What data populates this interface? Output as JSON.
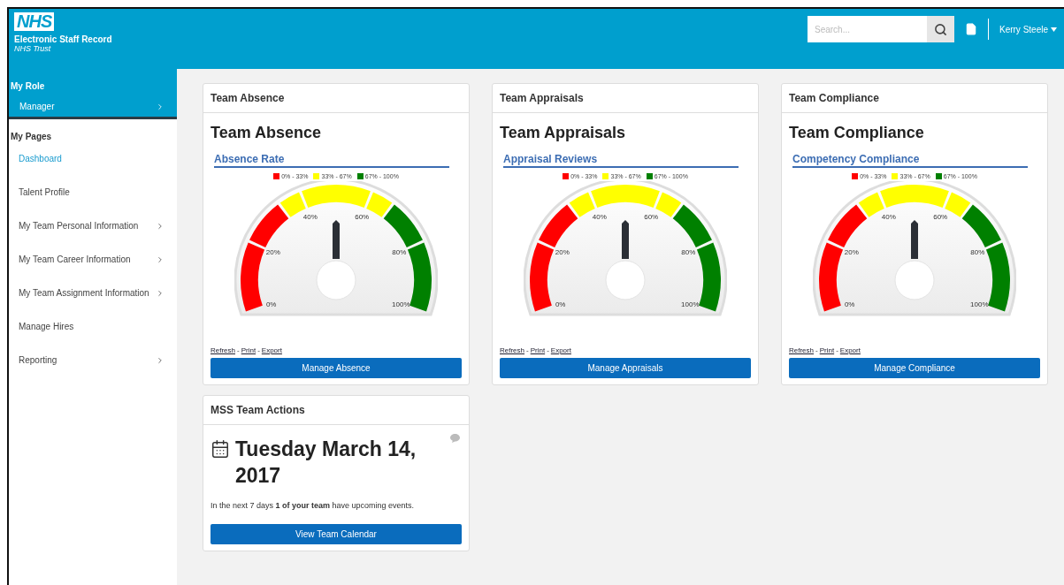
{
  "header": {
    "logo": "NHS",
    "app_name": "Electronic Staff Record",
    "org": "NHS Trust",
    "search": {
      "placeholder": "Search..."
    },
    "user": "Kerry Steele"
  },
  "sidebar": {
    "role_heading": "My Role",
    "role": {
      "label": "Manager",
      "has_children": true
    },
    "pages_heading": "My Pages",
    "items": [
      {
        "label": "Dashboard",
        "selected": true,
        "has_children": false
      },
      {
        "label": "Talent Profile",
        "selected": false,
        "has_children": false
      },
      {
        "label": "My Team Personal Information",
        "selected": false,
        "has_children": true
      },
      {
        "label": "My Team Career Information",
        "selected": false,
        "has_children": true
      },
      {
        "label": "My Team Assignment Information",
        "selected": false,
        "has_children": true
      },
      {
        "label": "Manage Hires",
        "selected": false,
        "has_children": false
      },
      {
        "label": "Reporting",
        "selected": false,
        "has_children": true
      }
    ]
  },
  "gauge_cards": [
    {
      "title": "Team Absence",
      "heading": "Team Absence",
      "subtitle": "Absence Rate",
      "legend": [
        {
          "label": "0% - 33%",
          "color": "#ff0000"
        },
        {
          "label": "33% - 67%",
          "color": "#ffff00"
        },
        {
          "label": "67% - 100%",
          "color": "#008000"
        }
      ],
      "ticks": [
        "0%",
        "20%",
        "40%",
        "60%",
        "80%",
        "100%"
      ],
      "links": [
        {
          "kind": "link",
          "label": "Refresh"
        },
        {
          "kind": "separator",
          "label": "-"
        },
        {
          "kind": "link",
          "label": "Print"
        },
        {
          "kind": "separator",
          "label": "-"
        },
        {
          "kind": "link",
          "label": "Export"
        }
      ],
      "button": "Manage Absence"
    },
    {
      "title": "Team Appraisals",
      "heading": "Team Appraisals",
      "subtitle": "Appraisal Reviews",
      "legend": [
        {
          "label": "0% - 33%",
          "color": "#ff0000"
        },
        {
          "label": "33% - 67%",
          "color": "#ffff00"
        },
        {
          "label": "67% - 100%",
          "color": "#008000"
        }
      ],
      "ticks": [
        "0%",
        "20%",
        "40%",
        "60%",
        "80%",
        "100%"
      ],
      "links": [
        {
          "kind": "link",
          "label": "Refresh"
        },
        {
          "kind": "separator",
          "label": "-"
        },
        {
          "kind": "link",
          "label": "Print"
        },
        {
          "kind": "separator",
          "label": "-"
        },
        {
          "kind": "link",
          "label": "Export"
        }
      ],
      "button": "Manage Appraisals"
    },
    {
      "title": "Team Compliance",
      "heading": "Team Compliance",
      "subtitle": "Competency Compliance",
      "legend": [
        {
          "label": "0% - 33%",
          "color": "#ff0000"
        },
        {
          "label": "33% - 67%",
          "color": "#ffff00"
        },
        {
          "label": "67% - 100%",
          "color": "#008000"
        }
      ],
      "ticks": [
        "0%",
        "20%",
        "40%",
        "60%",
        "80%",
        "100%"
      ],
      "links": [
        {
          "kind": "link",
          "label": "Refresh"
        },
        {
          "kind": "separator",
          "label": "-"
        },
        {
          "kind": "link",
          "label": "Print"
        },
        {
          "kind": "separator",
          "label": "-"
        },
        {
          "kind": "link",
          "label": "Export"
        }
      ],
      "button": "Manage Compliance"
    }
  ],
  "actions_card": {
    "title": "MSS Team Actions",
    "date": "Tuesday March 14, 2017",
    "message": "In the next 7 days **1 of your team** have upcoming events.",
    "button": "View Team Calendar"
  }
}
